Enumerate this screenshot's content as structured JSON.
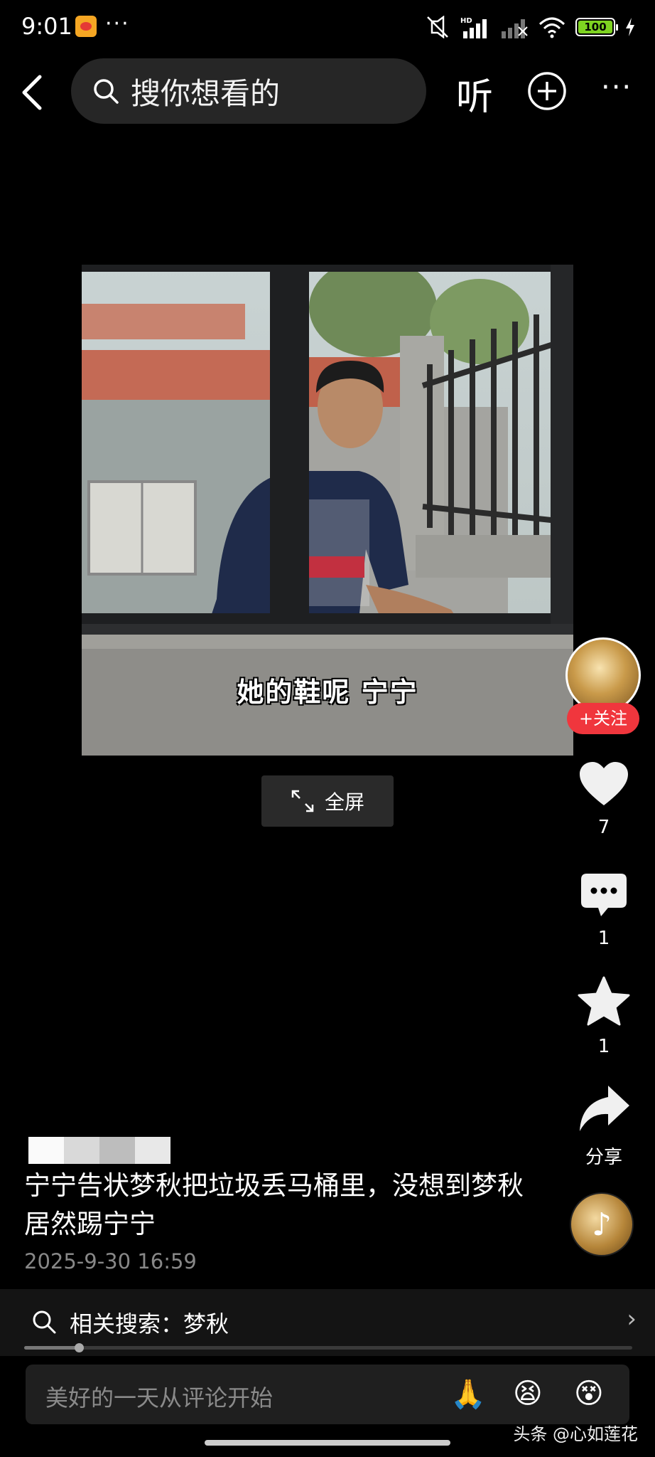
{
  "status_bar": {
    "time": "9:01",
    "more": "···",
    "network": "HD",
    "battery": "100"
  },
  "nav": {
    "search_placeholder": "搜你想看的",
    "listen_label": "听",
    "more": "···"
  },
  "video": {
    "subtitle": "她的鞋呢 宁宁",
    "fullscreen_label": "全屏"
  },
  "rail": {
    "follow_label": "+关注",
    "like_count": "7",
    "comment_count": "1",
    "favorite_count": "1",
    "share_label": "分享"
  },
  "post": {
    "title": "宁宁告状梦秋把垃圾丢马桶里，没想到梦秋居然踢宁宁",
    "date": "2025-9-30 16:59"
  },
  "related": {
    "label": "相关搜索：梦秋"
  },
  "playback": {
    "progress": 0.09
  },
  "comment": {
    "placeholder": "美好的一天从评论开始",
    "emojis": [
      "🙏",
      "😫",
      "😵"
    ]
  },
  "watermark": "头条 @心如莲花",
  "colors": {
    "accent": "#f0363d",
    "background": "#000000"
  }
}
